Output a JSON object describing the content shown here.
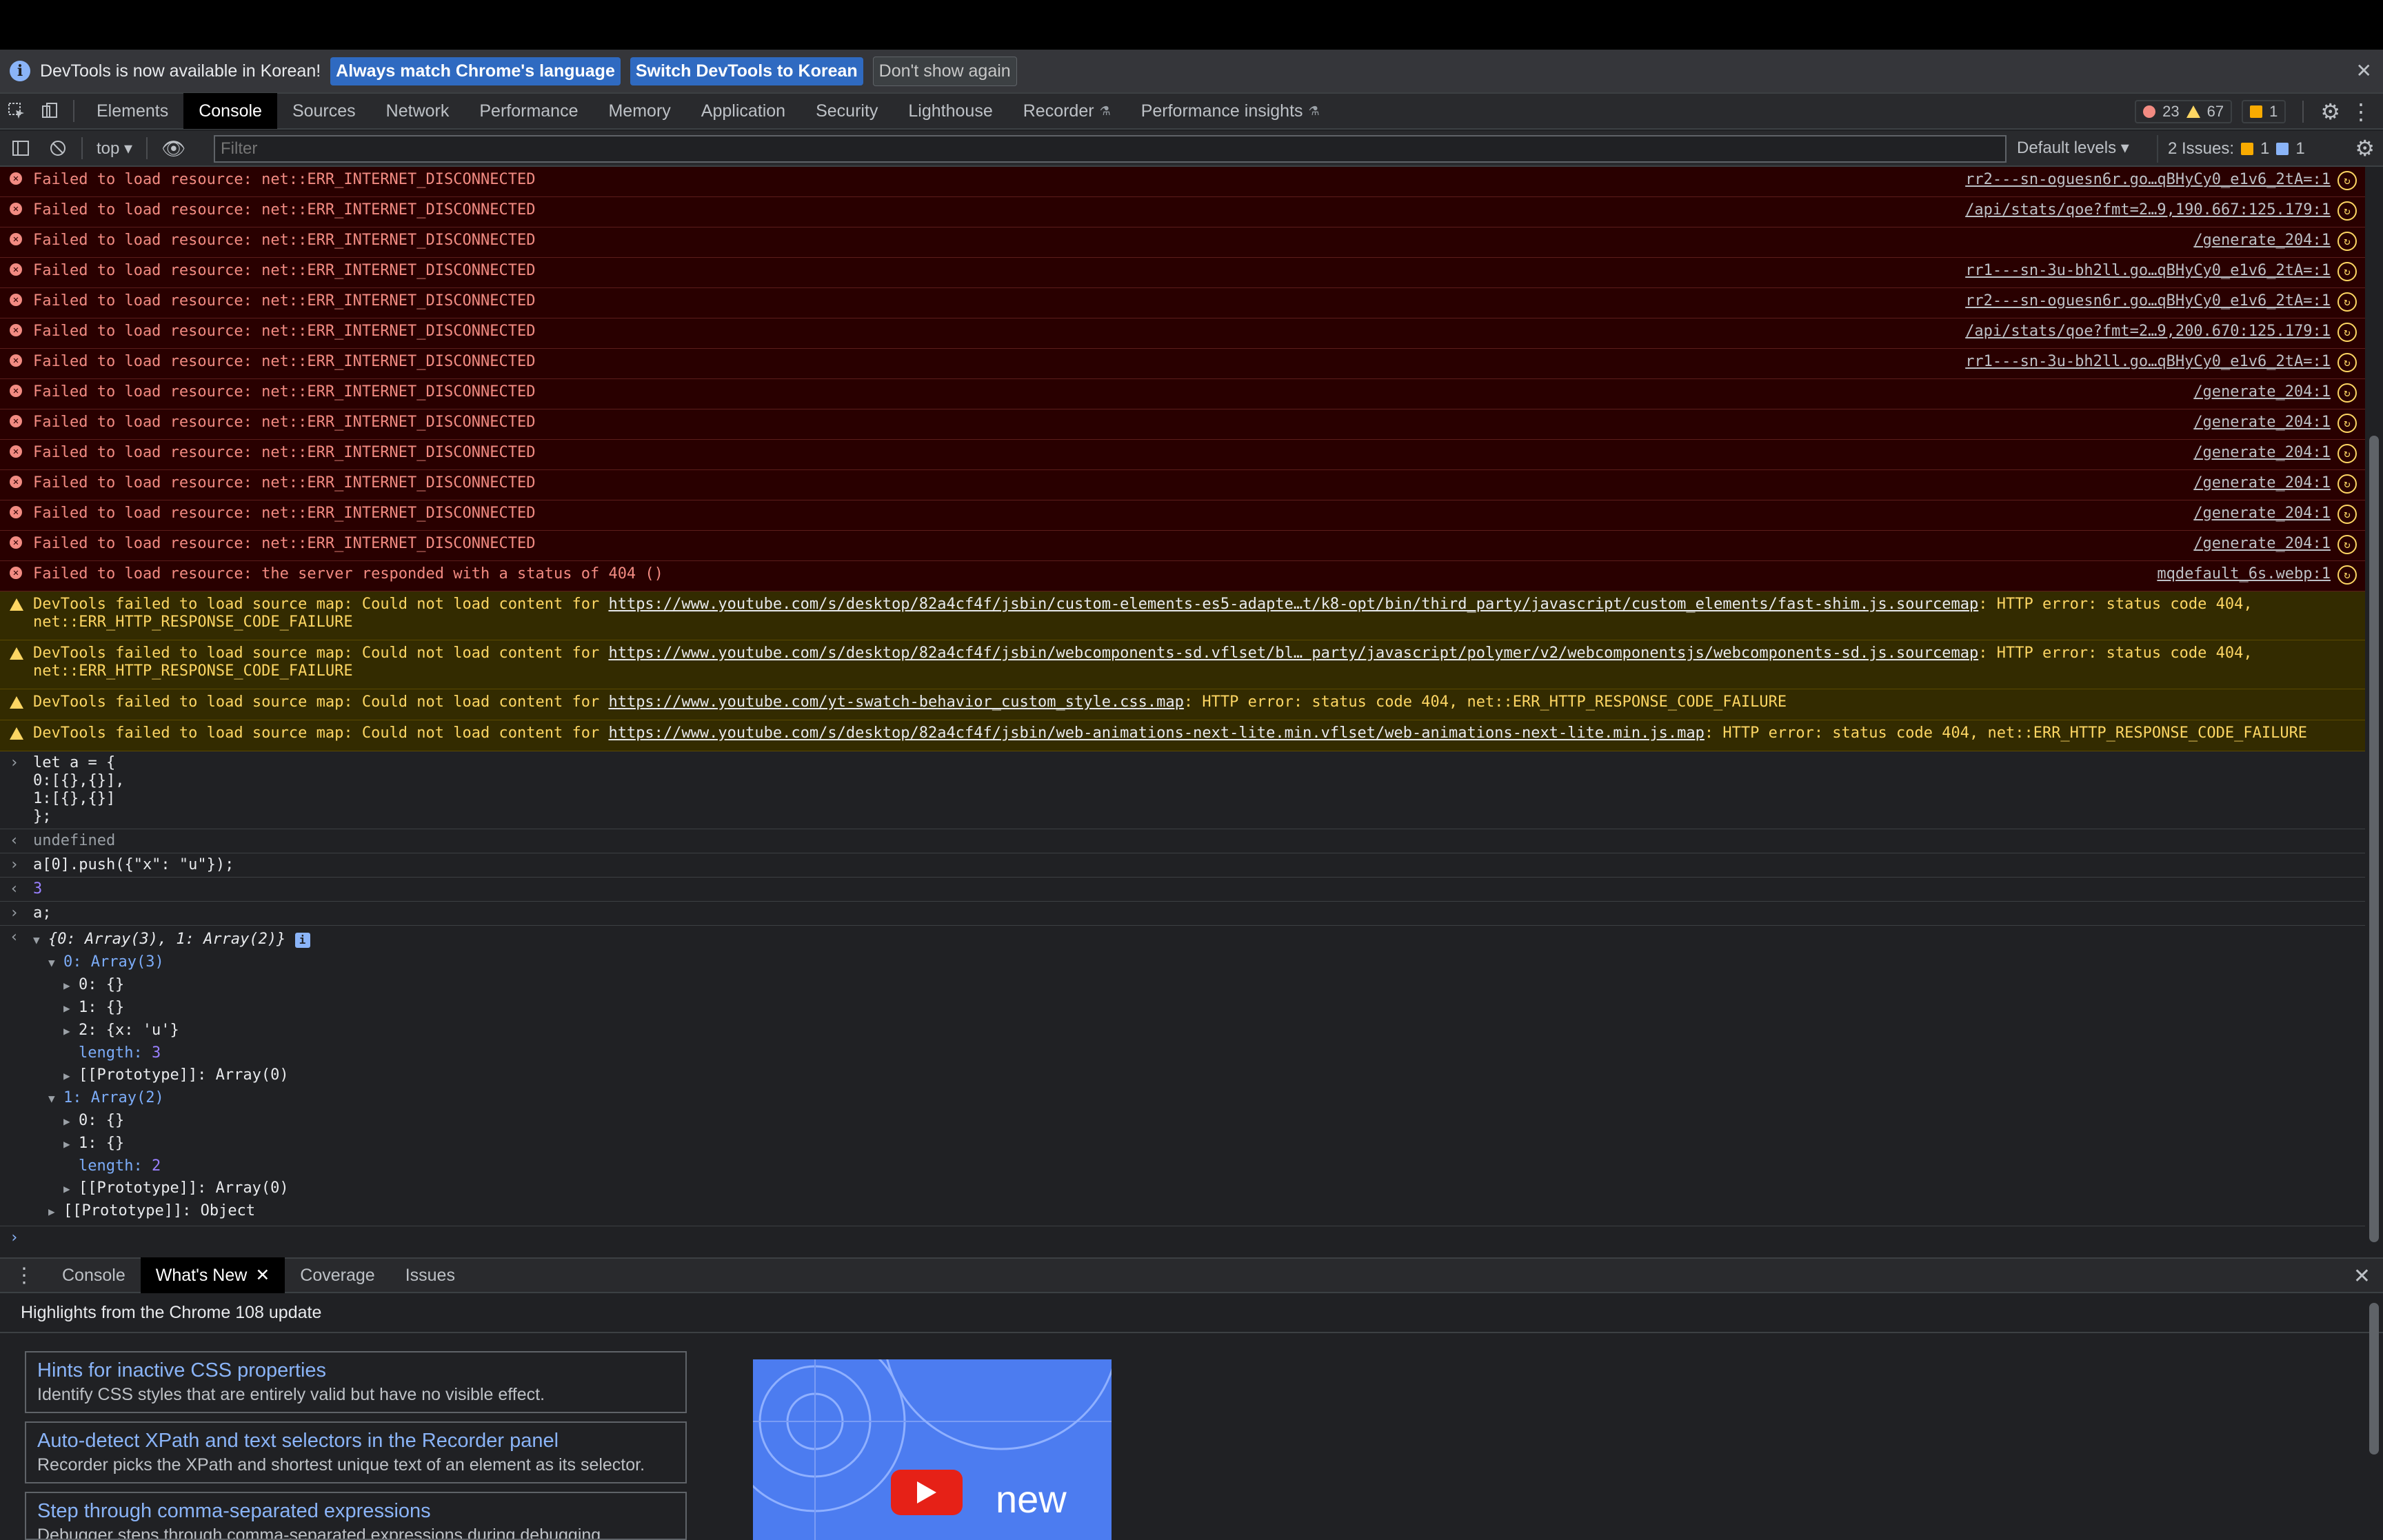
{
  "infobar": {
    "message": "DevTools is now available in Korean!",
    "btn_match": "Always match Chrome's language",
    "btn_switch": "Switch DevTools to Korean",
    "btn_dont": "Don't show again"
  },
  "tabs": [
    "Elements",
    "Console",
    "Sources",
    "Network",
    "Performance",
    "Memory",
    "Application",
    "Security",
    "Lighthouse",
    "Recorder",
    "Performance insights"
  ],
  "counters": {
    "errors": "23",
    "warnings": "67",
    "issues": "1"
  },
  "toolbar": {
    "context": "top",
    "filter_placeholder": "Filter",
    "levels": "Default levels",
    "issues_label": "2 Issues:",
    "issues_a": "1",
    "issues_b": "1"
  },
  "errors": [
    {
      "msg": "Failed to load resource: net::ERR_INTERNET_DISCONNECTED",
      "src": "rr2---sn-oguesn6r.go…qBHyCy0_e1v6_2tA=:1"
    },
    {
      "msg": "Failed to load resource: net::ERR_INTERNET_DISCONNECTED",
      "src": "/api/stats/qoe?fmt=2…9,190.667:125.179:1"
    },
    {
      "msg": "Failed to load resource: net::ERR_INTERNET_DISCONNECTED",
      "src": "/generate_204:1"
    },
    {
      "msg": "Failed to load resource: net::ERR_INTERNET_DISCONNECTED",
      "src": "rr1---sn-3u-bh2ll.go…qBHyCy0_e1v6_2tA=:1"
    },
    {
      "msg": "Failed to load resource: net::ERR_INTERNET_DISCONNECTED",
      "src": "rr2---sn-oguesn6r.go…qBHyCy0_e1v6_2tA=:1"
    },
    {
      "msg": "Failed to load resource: net::ERR_INTERNET_DISCONNECTED",
      "src": "/api/stats/qoe?fmt=2…9,200.670:125.179:1"
    },
    {
      "msg": "Failed to load resource: net::ERR_INTERNET_DISCONNECTED",
      "src": "rr1---sn-3u-bh2ll.go…qBHyCy0_e1v6_2tA=:1"
    },
    {
      "msg": "Failed to load resource: net::ERR_INTERNET_DISCONNECTED",
      "src": "/generate_204:1"
    },
    {
      "msg": "Failed to load resource: net::ERR_INTERNET_DISCONNECTED",
      "src": "/generate_204:1"
    },
    {
      "msg": "Failed to load resource: net::ERR_INTERNET_DISCONNECTED",
      "src": "/generate_204:1"
    },
    {
      "msg": "Failed to load resource: net::ERR_INTERNET_DISCONNECTED",
      "src": "/generate_204:1"
    },
    {
      "msg": "Failed to load resource: net::ERR_INTERNET_DISCONNECTED",
      "src": "/generate_204:1"
    },
    {
      "msg": "Failed to load resource: net::ERR_INTERNET_DISCONNECTED",
      "src": "/generate_204:1"
    },
    {
      "msg": "Failed to load resource: the server responded with a status of 404 ()",
      "src": "mqdefault_6s.webp:1"
    }
  ],
  "warnings": [
    {
      "pre": "DevTools failed to load source map: Could not load content for ",
      "url": "https://www.youtube.com/s/desktop/82a4cf4f/jsbin/custom-elements-es5-adapte…t/k8-opt/bin/third_party/javascript/custom_elements/fast-shim.js.sourcemap",
      "post": ": HTTP error: status code 404, net::ERR_HTTP_RESPONSE_CODE_FAILURE"
    },
    {
      "pre": "DevTools failed to load source map: Could not load content for ",
      "url": "https://www.youtube.com/s/desktop/82a4cf4f/jsbin/webcomponents-sd.vflset/bl… party/javascript/polymer/v2/webcomponentsjs/webcomponents-sd.js.sourcemap",
      "post": ": HTTP error: status code 404, net::ERR_HTTP_RESPONSE_CODE_FAILURE"
    },
    {
      "pre": "DevTools failed to load source map: Could not load content for ",
      "url": "https://www.youtube.com/yt-swatch-behavior_custom_style.css.map",
      "post": ": HTTP error: status code 404, net::ERR_HTTP_RESPONSE_CODE_FAILURE"
    },
    {
      "pre": "DevTools failed to load source map: Could not load content for ",
      "url": "https://www.youtube.com/s/desktop/82a4cf4f/jsbin/web-animations-next-lite.min.vflset/web-animations-next-lite.min.js.map",
      "post": ": HTTP error: status code 404, net::ERR_HTTP_RESPONSE_CODE_FAILURE"
    }
  ],
  "repl": {
    "in1_l1": "let a = {",
    "in1_l2": "0:[{},{}],",
    "in1_l3": "1:[{},{}]",
    "in1_l4": "};",
    "out1": "undefined",
    "in2": "a[0].push({\"x\": \"u\"});",
    "out2": "3",
    "in3": "a;",
    "out3": "{0: Array(3), 1: Array(2)}",
    "t0": "0: Array(3)",
    "t0_0": "0: {}",
    "t0_1": "1: {}",
    "t0_2": "2: {x: 'u'}",
    "t0_len_k": "length:",
    "t0_len_v": "3",
    "t0_proto": "[[Prototype]]: Array(0)",
    "t1": "1: Array(2)",
    "t1_0": "0: {}",
    "t1_1": "1: {}",
    "t1_len_k": "length:",
    "t1_len_v": "2",
    "t1_proto": "[[Prototype]]: Array(0)",
    "proto": "[[Prototype]]: Object"
  },
  "drawer": {
    "tabs": [
      "Console",
      "What's New",
      "Coverage",
      "Issues"
    ],
    "highlights": "Highlights from the Chrome 108 update",
    "cards": [
      {
        "title": "Hints for inactive CSS properties",
        "desc": "Identify CSS styles that are entirely valid but have no visible effect."
      },
      {
        "title": "Auto-detect XPath and text selectors in the Recorder panel",
        "desc": "Recorder picks the XPath and shortest unique text of an element as its selector."
      },
      {
        "title": "Step through comma-separated expressions",
        "desc": "Debugger steps through comma-separated expressions during debugging."
      }
    ],
    "video_text": "new"
  },
  "colors": {
    "error_bg": "#290000",
    "warn_bg": "#332b00",
    "accent": "#8ab4f8"
  }
}
